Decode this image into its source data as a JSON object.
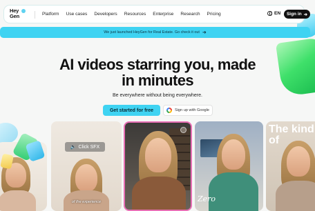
{
  "nav": {
    "logo_line1": "Hey",
    "logo_line2": "Gen",
    "menu": [
      "Platform",
      "Use cases",
      "Developers",
      "Resources",
      "Enterprise",
      "Research",
      "Pricing"
    ],
    "language": "EN",
    "signin_label": "Sign in",
    "signin_icon": "arrow-right-icon"
  },
  "banner": {
    "text": "We just launched HeyGen for Real Estate. Go check it out",
    "icon": "arrow-right-icon"
  },
  "hero": {
    "title_line1": "AI videos starring you, made",
    "title_line2": "in minutes",
    "subtitle": "Be everywhere without being everywhere.",
    "cta_primary": "Get started for free",
    "cta_google": "Sign up with Google"
  },
  "cards": {
    "card1_chip": "Click SFX",
    "card1_caption": "of the experience",
    "card3_text": "Zero",
    "card4_text": "The kind of"
  },
  "colors": {
    "accent": "#3fd3f2",
    "highlight_border": "#e86fb5",
    "dark": "#111111"
  }
}
